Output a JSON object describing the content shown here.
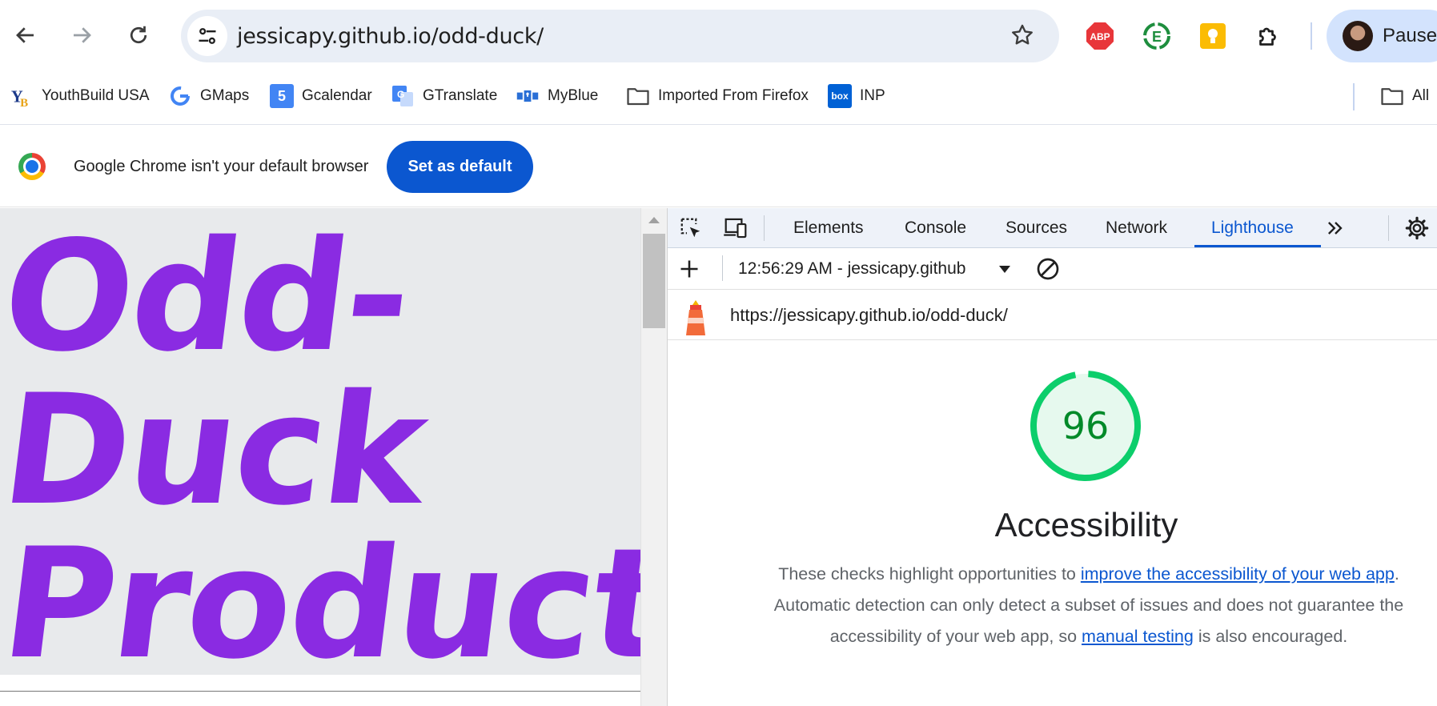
{
  "browser": {
    "url": "jessicapy.github.io/odd-duck/",
    "profile_label": "Pausec",
    "extensions": [
      {
        "name": "AdBlock Plus",
        "icon": "abp-icon",
        "text": "ABP"
      },
      {
        "name": "E",
        "icon": "e-extension-icon",
        "text": "E"
      },
      {
        "name": "Keep",
        "icon": "keep-icon"
      },
      {
        "name": "Extensions",
        "icon": "puzzle-icon"
      }
    ]
  },
  "bookmarks": [
    {
      "label": "YouthBuild USA",
      "icon": "youthbuild-icon"
    },
    {
      "label": "GMaps",
      "icon": "google-icon"
    },
    {
      "label": "Gcalendar",
      "icon": "calendar-icon",
      "glyph": "5"
    },
    {
      "label": "GTranslate",
      "icon": "translate-icon"
    },
    {
      "label": "MyBlue",
      "icon": "myblue-icon"
    },
    {
      "label": "Imported From Firefox",
      "icon": "folder-icon"
    },
    {
      "label": "INP",
      "icon": "box-icon",
      "glyph": "box"
    },
    {
      "label": "All",
      "icon": "folder-icon"
    }
  ],
  "infobar": {
    "message": "Google Chrome isn't your default browser",
    "button": "Set as default"
  },
  "page": {
    "hero_lines": [
      "Odd-",
      "Duck",
      "Product"
    ]
  },
  "devtools": {
    "tabs": [
      "Elements",
      "Console",
      "Sources",
      "Network",
      "Lighthouse"
    ],
    "active_tab": "Lighthouse",
    "report_selector": "12:56:29 AM - jessicapy.github",
    "audited_url": "https://jessicapy.github.io/odd-duck/",
    "category": {
      "score": "96",
      "score_value": 0.96,
      "title": "Accessibility",
      "desc_1": "These checks highlight opportunities to ",
      "link_1": "improve the accessibility of your web app",
      "desc_2": ". Automatic detection can only detect a subset of issues and does not guarantee the accessibility of your web app, so ",
      "link_2": "manual testing",
      "desc_3": " is also encouraged."
    },
    "colors": {
      "score_good": "#0cce6b",
      "score_text": "#008a29",
      "active_tab": "#0b57d0"
    }
  }
}
